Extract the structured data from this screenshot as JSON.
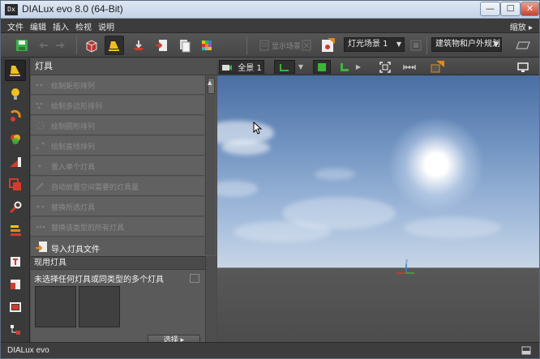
{
  "window": {
    "title": "DIALux evo 8.0  (64-Bit)",
    "app_icon": "Dx",
    "minimize": "—",
    "maximize": "☐",
    "close": "✕"
  },
  "menu": {
    "items": [
      "文件",
      "编辑",
      "插入",
      "检视",
      "说明"
    ],
    "zoom_label": "缩放 ▸"
  },
  "toolbar": {
    "scene_select": "灯光场景 1",
    "mode_select": "建筑物和户外规划",
    "dim_label": "显示场景"
  },
  "panel": {
    "title": "灯具",
    "tools": [
      {
        "label": "绘制矩形排列",
        "enabled": false
      },
      {
        "label": "绘制多边形排列",
        "enabled": false
      },
      {
        "label": "绘制圆形排列",
        "enabled": false
      },
      {
        "label": "绘制直线排列",
        "enabled": false
      },
      {
        "label": "置入单个灯具",
        "enabled": false
      },
      {
        "label": "自动放置空间需要的灯具量",
        "enabled": false
      },
      {
        "label": "替换所选灯具",
        "enabled": false
      },
      {
        "label": "替换该类型的所有灯具",
        "enabled": false
      },
      {
        "label": "导入灯具文件",
        "enabled": true
      }
    ],
    "current_header": "现用灯具",
    "current_message": "未选择任何灯具或同类型的多个灯具",
    "select_button": "选择  ▸"
  },
  "viewport": {
    "view_button": "全景 1",
    "axis_z": "z"
  },
  "status": {
    "logo": "DIALux evo"
  },
  "colors": {
    "accent_yellow": "#f0c020",
    "green": "#3cb43c",
    "red": "#d23c2c",
    "orange": "#e08a1e"
  }
}
